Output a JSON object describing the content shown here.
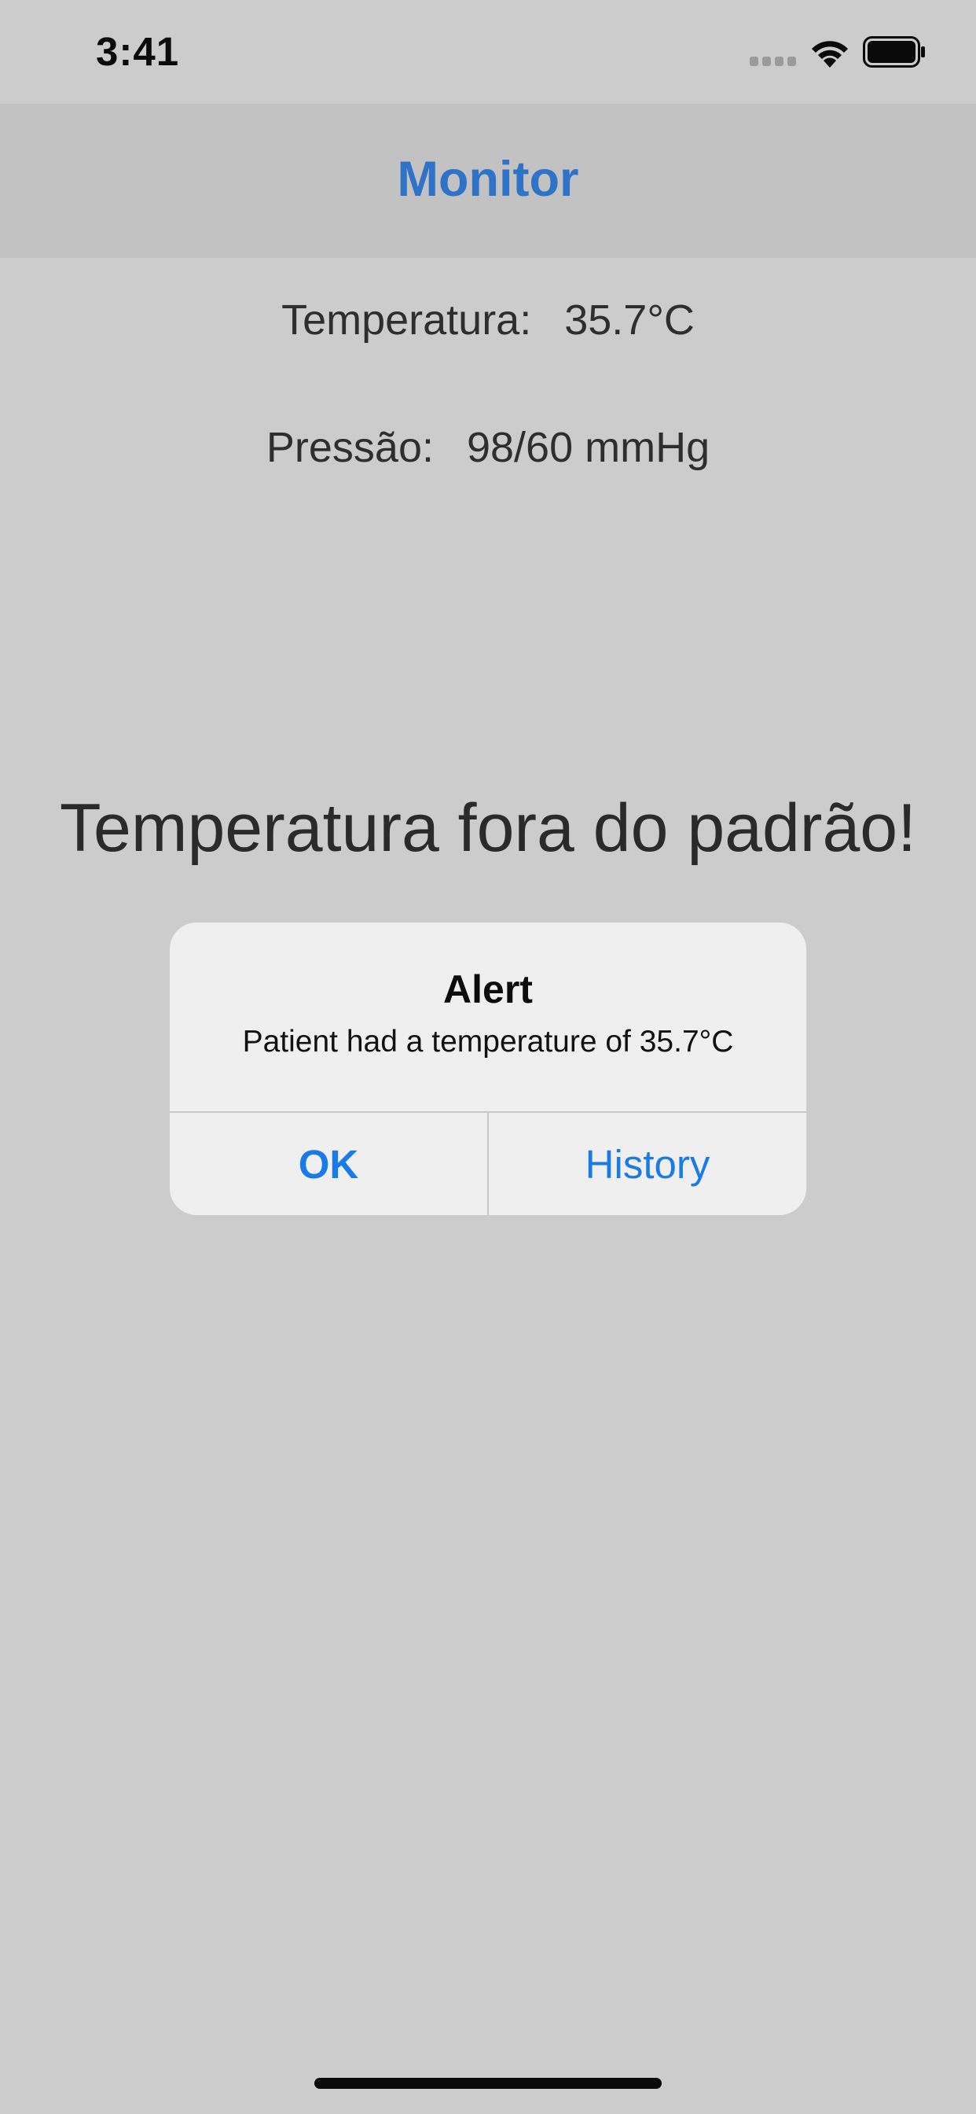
{
  "status_bar": {
    "time": "3:41",
    "icons": [
      "cellular-signal-icon",
      "wifi-icon",
      "battery-icon"
    ]
  },
  "nav": {
    "title": "Monitor"
  },
  "readings": {
    "temperature_label": "Temperatura:",
    "temperature_value": "35.7°C",
    "pressure_label": "Pressão:",
    "pressure_value": "98/60 mmHg"
  },
  "warning": "Temperatura fora do padrão!",
  "alert": {
    "title": "Alert",
    "message": "Patient had a temperature of 35.7°C",
    "buttons": {
      "ok": "OK",
      "history": "History"
    }
  },
  "colors": {
    "background": "#cccccc",
    "nav_background": "#c2c2c2",
    "nav_title": "#2f73c8",
    "alert_background": "#efefef",
    "alert_button": "#1a7be6"
  }
}
